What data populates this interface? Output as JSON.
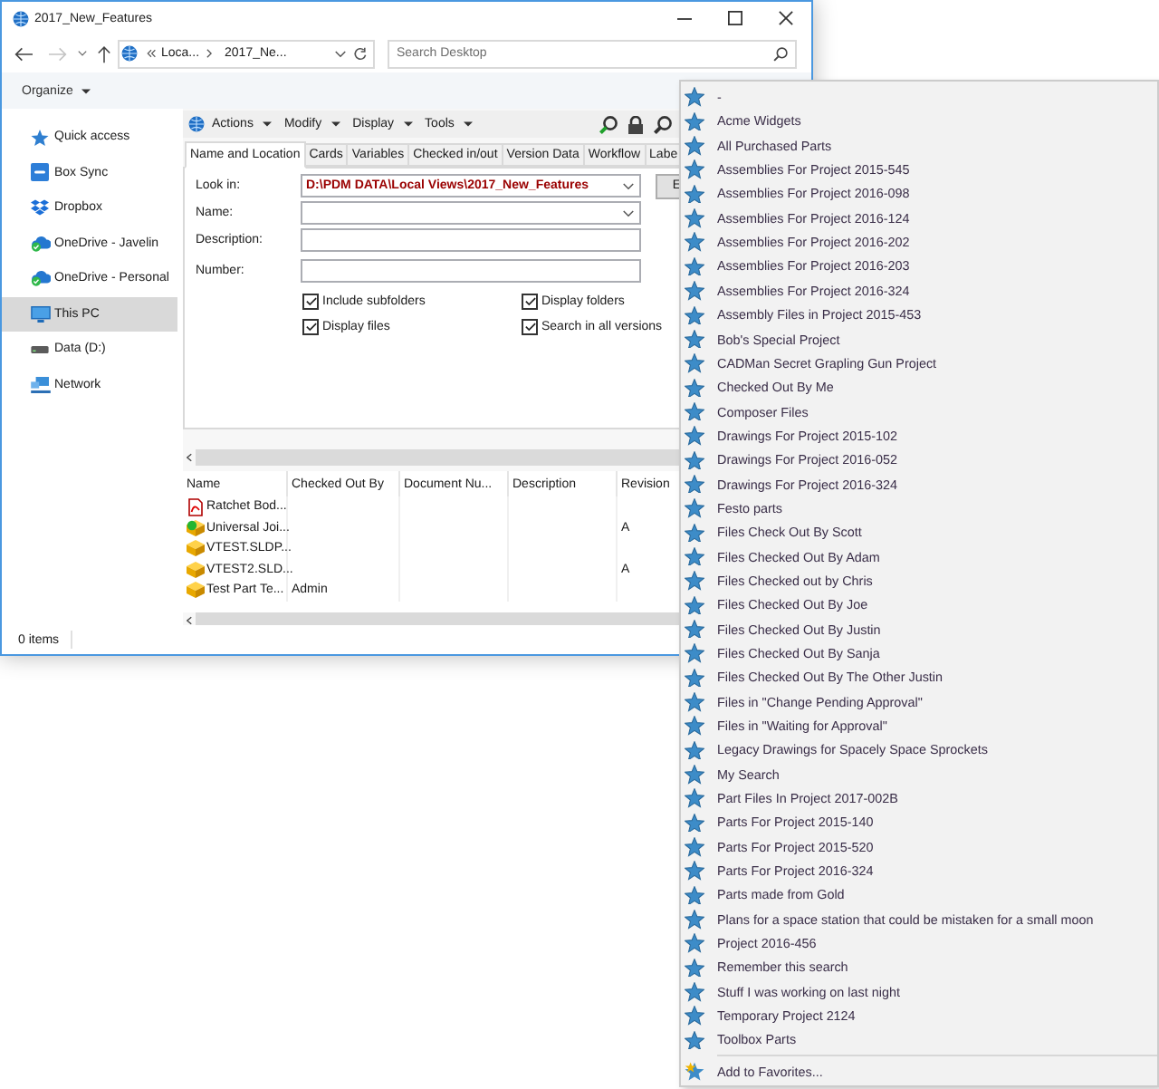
{
  "window": {
    "title": "2017_New_Features"
  },
  "address_bar": {
    "breadcrumbs": [
      "Loca...",
      "2017_Ne..."
    ]
  },
  "search": {
    "placeholder": "Search Desktop"
  },
  "command_bar": {
    "organize": "Organize"
  },
  "navigation": {
    "items": [
      {
        "label": "Quick access",
        "selected": false
      },
      {
        "label": "Box Sync",
        "selected": false
      },
      {
        "label": "Dropbox",
        "selected": false
      },
      {
        "label": "OneDrive - Javelin",
        "selected": false
      },
      {
        "label": "OneDrive - Personal",
        "selected": false
      },
      {
        "label": "This PC",
        "selected": true
      },
      {
        "label": "Data (D:)",
        "selected": false
      },
      {
        "label": "Network",
        "selected": false
      }
    ]
  },
  "pdm": {
    "menus": [
      "Actions",
      "Modify",
      "Display",
      "Tools"
    ],
    "tabs": [
      {
        "label": "Name and Location",
        "selected": true
      },
      {
        "label": "Cards",
        "selected": false
      },
      {
        "label": "Variables",
        "selected": false
      },
      {
        "label": "Checked in/out",
        "selected": false
      },
      {
        "label": "Version Data",
        "selected": false
      },
      {
        "label": "Workflow",
        "selected": false
      },
      {
        "label": "Labe",
        "selected": false
      }
    ],
    "form": {
      "look_in": {
        "label": "Look in:",
        "value": "D:\\PDM DATA\\Local Views\\2017_New_Features"
      },
      "side_button": "E",
      "fields": [
        {
          "label": "Name:",
          "kind": "combo"
        },
        {
          "label": "Description:",
          "kind": "text"
        },
        {
          "label": "Number:",
          "kind": "text"
        }
      ],
      "checkboxes": [
        {
          "label": "Include subfolders",
          "checked": true
        },
        {
          "label": "Display folders",
          "checked": true
        },
        {
          "label": "Display files",
          "checked": true
        },
        {
          "label": "Search in all versions",
          "checked": true
        }
      ]
    },
    "results": {
      "columns": [
        "Name",
        "Checked Out By",
        "Document Nu...",
        "Description",
        "Revision"
      ],
      "rows": [
        {
          "kind": "pdf",
          "name": "Ratchet Bod..."
        },
        {
          "kind": "assembly",
          "name": "Universal Joi...",
          "revision": "A"
        },
        {
          "kind": "part",
          "name": "VTEST.SLDP..."
        },
        {
          "kind": "part",
          "name": "VTEST2.SLD...",
          "revision": "A"
        },
        {
          "kind": "part",
          "name": "Test Part Te...",
          "checked_out_by": "Admin"
        }
      ]
    }
  },
  "status_bar": {
    "text": "0 items"
  },
  "favorites_menu": {
    "items": [
      "-",
      "Acme Widgets",
      "All Purchased Parts",
      "Assemblies For Project 2015-545",
      "Assemblies For Project 2016-098",
      "Assemblies For Project 2016-124",
      "Assemblies For Project 2016-202",
      "Assemblies For Project 2016-203",
      "Assemblies For Project 2016-324",
      "Assembly Files in Project 2015-453",
      "Bob's Special Project",
      "CADMan Secret Grapling Gun Project",
      "Checked Out By Me",
      "Composer Files",
      "Drawings For Project 2015-102",
      "Drawings For Project 2016-052",
      "Drawings For Project 2016-324",
      "Festo parts",
      "Files Check Out By Scott",
      "Files Checked Out By Adam",
      "Files Checked out by Chris",
      "Files Checked Out By Joe",
      "Files Checked Out By Justin",
      "Files Checked Out By Sanja",
      "Files Checked Out By The Other Justin",
      "Files in \"Change Pending Approval\"",
      "Files in \"Waiting for Approval\"",
      "Legacy Drawings for Spacely Space Sprockets",
      "My Search",
      "Part Files In Project 2017-002B",
      "Parts For Project 2015-140",
      "Parts For Project 2015-520",
      "Parts For Project 2016-324",
      "Parts made from Gold",
      "Plans for a space station that could be mistaken for a small moon",
      "Project 2016-456",
      "Remember this search",
      "Stuff I was working on last night",
      "Temporary Project 2124",
      "Toolbox Parts"
    ],
    "add_item": "Add to Favorites..."
  }
}
